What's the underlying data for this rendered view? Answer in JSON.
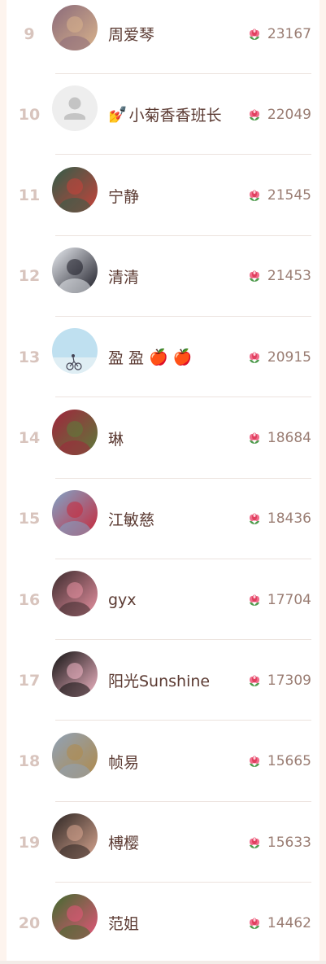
{
  "ranking": [
    {
      "rank": "9",
      "name": "周爱琴",
      "score": "23167",
      "avatar": "photo-woman-glasses",
      "colors": [
        "#8a6a7a",
        "#d9b38c"
      ]
    },
    {
      "rank": "10",
      "name": "小菊香香班长",
      "name_prefix_emoji": "💅",
      "score": "22049",
      "avatar": "default-avatar",
      "colors": [
        "#eeeeee",
        "#c4c4c4"
      ]
    },
    {
      "rank": "11",
      "name": "宁静",
      "score": "21545",
      "avatar": "photo-woman-tree",
      "colors": [
        "#2f5e4a",
        "#c8423a"
      ]
    },
    {
      "rank": "12",
      "name": "清清",
      "score": "21453",
      "avatar": "photo-woman-suit",
      "colors": [
        "#e9ecf1",
        "#1c1c26"
      ]
    },
    {
      "rank": "13",
      "name": "盈 盈",
      "name_suffix_emojis": [
        "🍎",
        "🍎"
      ],
      "score": "20915",
      "avatar": "photo-sky-cyclist",
      "colors": [
        "#bfe0f0",
        "#7fb6cf"
      ]
    },
    {
      "rank": "14",
      "name": "琳",
      "score": "18684",
      "avatar": "photo-red-flowers",
      "colors": [
        "#a1243d",
        "#5c7b3a"
      ]
    },
    {
      "rank": "15",
      "name": "江敏慈",
      "score": "18436",
      "avatar": "photo-red-coat-snow",
      "colors": [
        "#7fa5c9",
        "#c8283a"
      ]
    },
    {
      "rank": "16",
      "name": "gyx",
      "score": "17704",
      "avatar": "photo-pink-rose",
      "colors": [
        "#3b2a2c",
        "#e892a2"
      ]
    },
    {
      "rank": "17",
      "name": "阳光Sunshine",
      "score": "17309",
      "avatar": "photo-lotus",
      "colors": [
        "#111111",
        "#f2b7c6"
      ]
    },
    {
      "rank": "18",
      "name": "帧易",
      "score": "15665",
      "avatar": "photo-field-birds",
      "colors": [
        "#8fa2b8",
        "#b08a4a"
      ]
    },
    {
      "rank": "19",
      "name": "榑樱",
      "score": "15633",
      "avatar": "photo-woman-portrait",
      "colors": [
        "#2c2523",
        "#d8a690"
      ]
    },
    {
      "rank": "20",
      "name": "范姐",
      "score": "14462",
      "avatar": "photo-pink-blossoms",
      "colors": [
        "#3f6b2e",
        "#e6557a"
      ]
    }
  ],
  "flower_icon": "pink-flower-icon",
  "colors": {
    "rank_number": "#d8c4bd",
    "name": "#5b3a32",
    "score": "#9a7d73",
    "background": "#fdf4ee"
  }
}
